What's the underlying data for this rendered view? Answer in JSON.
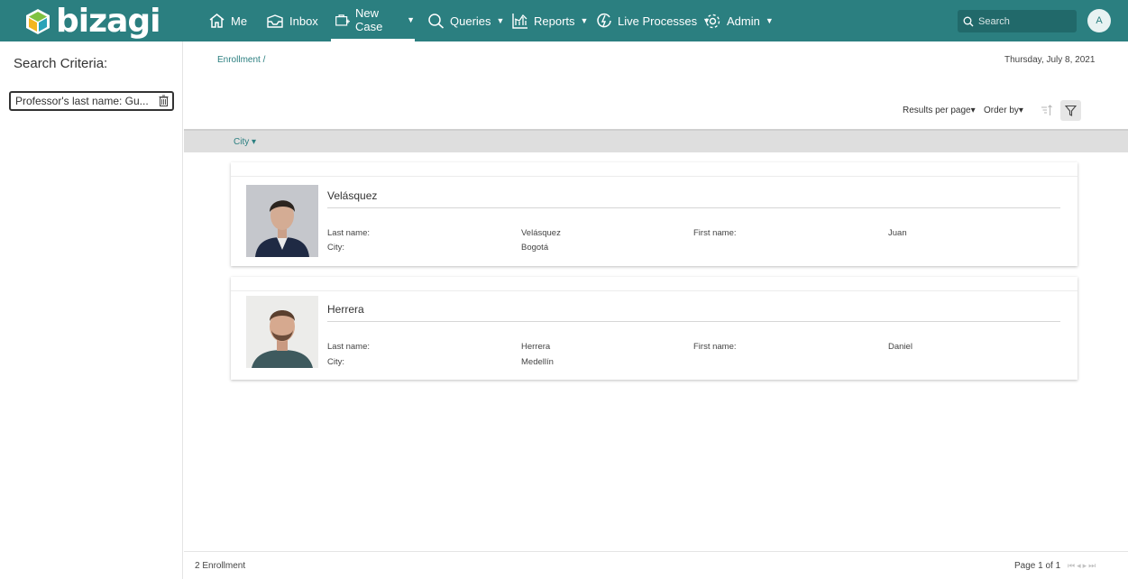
{
  "brand": {
    "name": "bizagi",
    "colors": {
      "header": "#2b7f80",
      "accent": "#2b7f80"
    }
  },
  "nav": {
    "items": [
      {
        "label": "Me",
        "icon": "home-icon"
      },
      {
        "label": "Inbox",
        "icon": "inbox-icon"
      },
      {
        "label": "New Case",
        "icon": "new-case-icon",
        "active": true
      },
      {
        "label": "Queries",
        "icon": "search-icon"
      },
      {
        "label": "Reports",
        "icon": "reports-icon"
      },
      {
        "label": "Live Processes",
        "icon": "live-processes-icon"
      },
      {
        "label": "Admin",
        "icon": "gear-icon"
      }
    ],
    "search_placeholder": "Search",
    "avatar_initial": "A"
  },
  "left": {
    "title": "Search Criteria:",
    "criteria": "Professor's last name: Gu..."
  },
  "main": {
    "breadcrumb": "Enrollment /",
    "date": "Thursday, July 8, 2021",
    "results_per_page": "Results per page",
    "order_by": "Order by",
    "group_by": "City",
    "records": [
      {
        "title": "Velásquez",
        "last_name_label": "Last name:",
        "last_name": "Velásquez",
        "first_name_label": "First name:",
        "first_name": "Juan",
        "city_label": "City:",
        "city": "Bogotá"
      },
      {
        "title": "Herrera",
        "last_name_label": "Last name:",
        "last_name": "Herrera",
        "first_name_label": "First name:",
        "first_name": "Daniel",
        "city_label": "City:",
        "city": "Medellín"
      }
    ],
    "footer": {
      "count": "2 Enrollment",
      "page": "Page 1 of 1"
    }
  }
}
